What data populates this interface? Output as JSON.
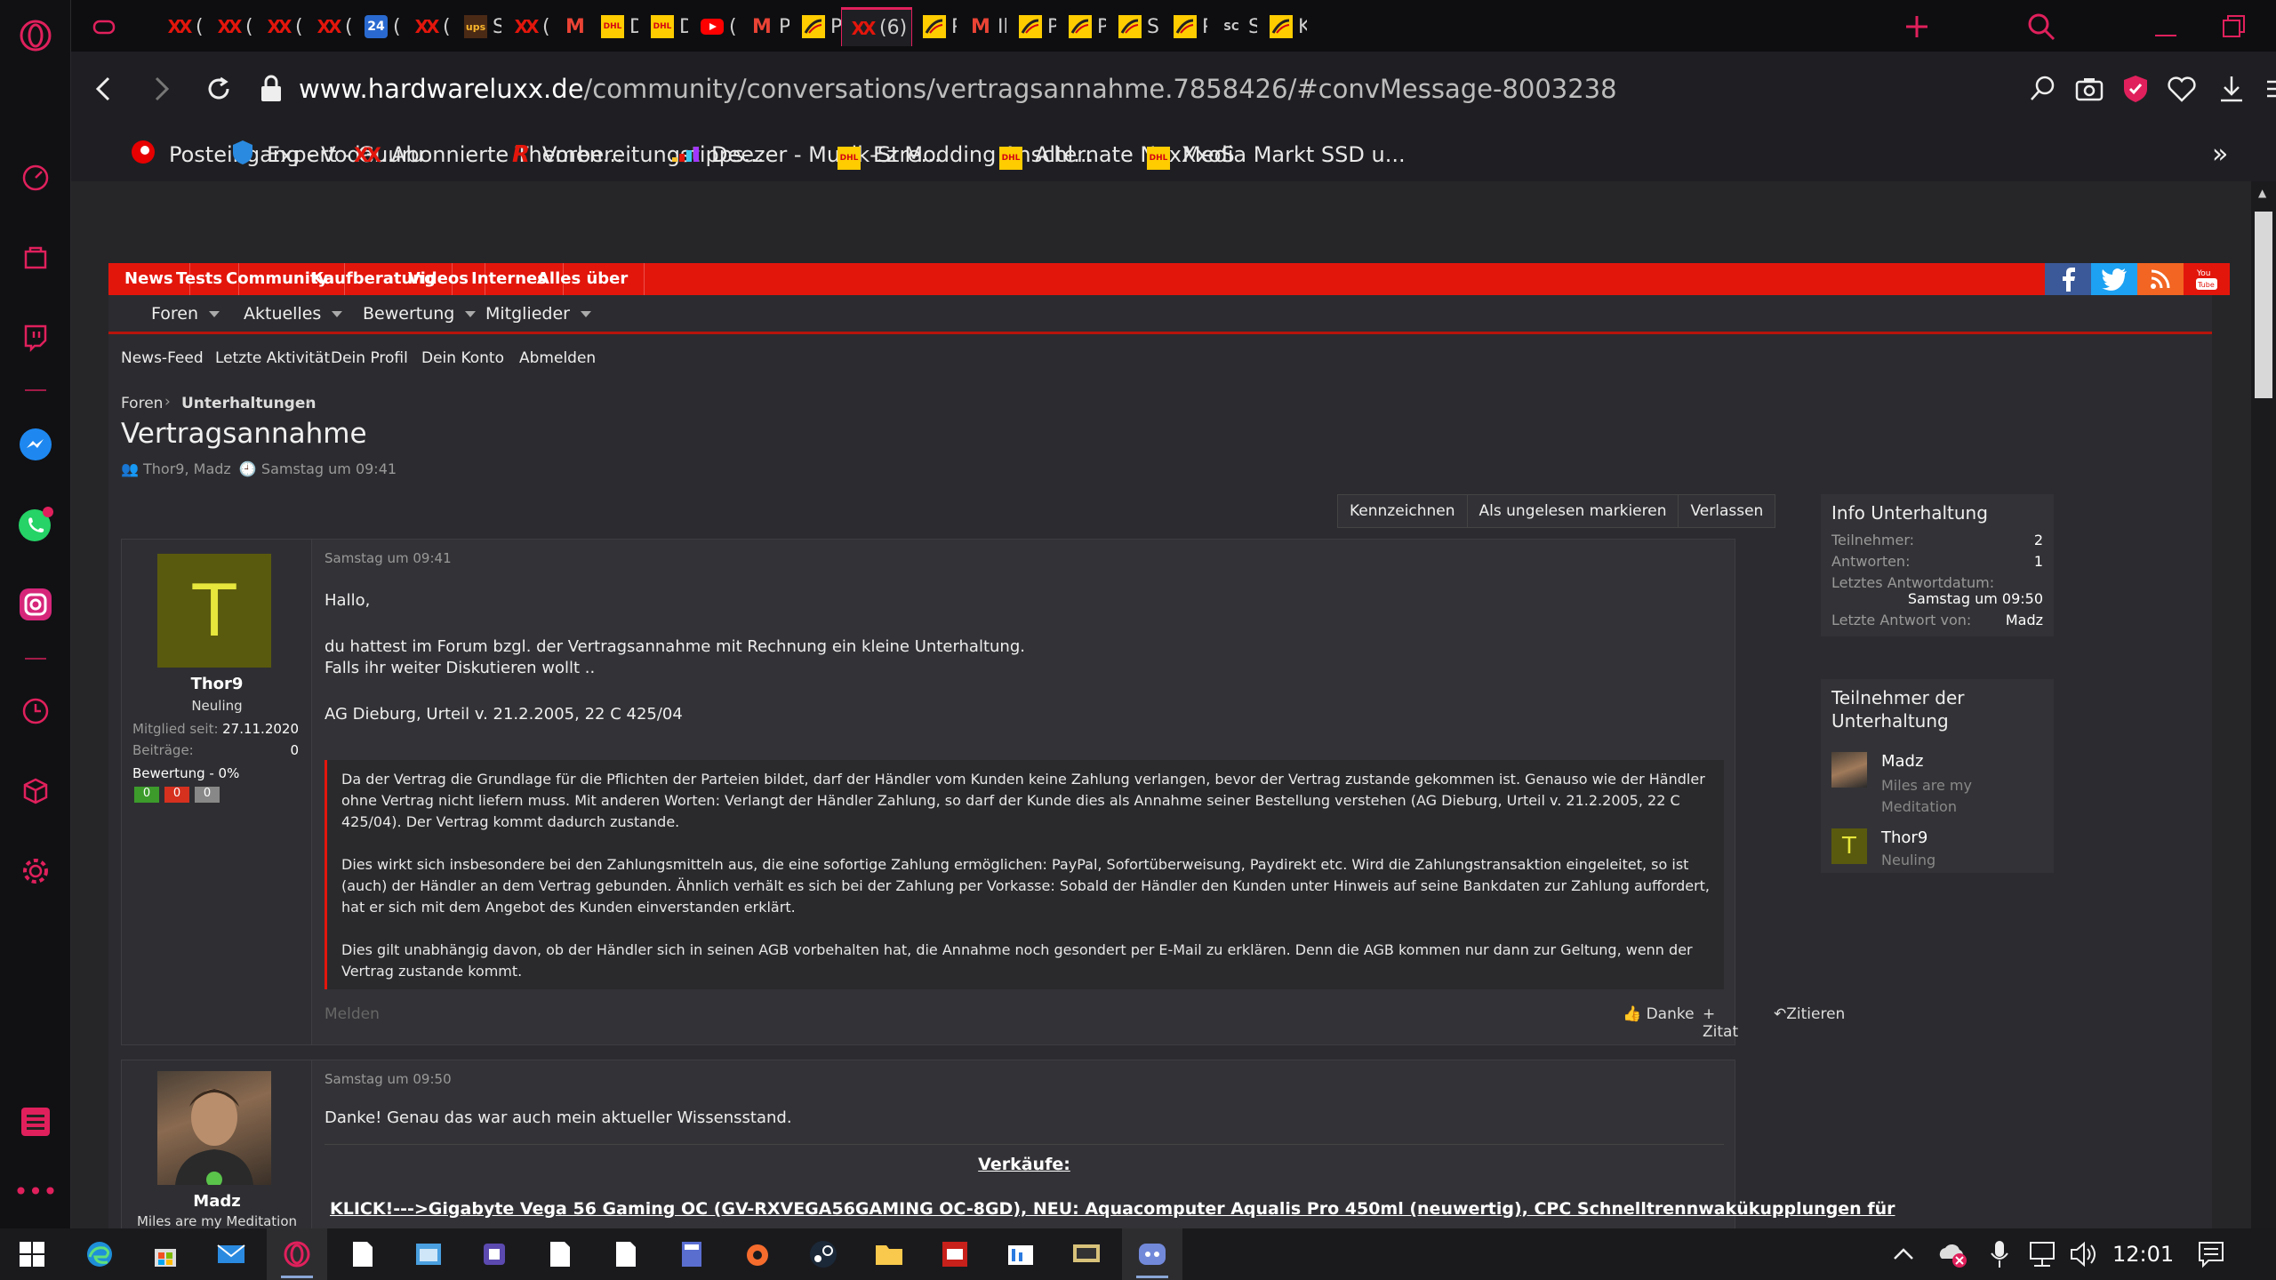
{
  "tabs": [
    {
      "favicon": "gamepad-icon",
      "label": "",
      "active": false
    },
    {
      "favicon": "hardwareluxx-icon",
      "label": "(E",
      "active": false
    },
    {
      "favicon": "hardwareluxx-icon",
      "label": "(E",
      "active": false
    },
    {
      "favicon": "hardwareluxx-icon",
      "label": "(E",
      "active": false
    },
    {
      "favicon": "hardwareluxx-icon",
      "label": "(E",
      "active": false
    },
    {
      "favicon": "24-icon",
      "label": "(E",
      "active": false
    },
    {
      "favicon": "hardwareluxx-icon",
      "label": "(E",
      "active": false
    },
    {
      "favicon": "ups-icon",
      "label": "Sı",
      "active": false
    },
    {
      "favicon": "hardwareluxx-icon",
      "label": "(E",
      "active": false
    },
    {
      "favicon": "gmail-icon",
      "label": "D",
      "active": false
    },
    {
      "favicon": "dhl-icon",
      "label": "D",
      "active": false
    },
    {
      "favicon": "dhl-icon",
      "label": "D",
      "active": false
    },
    {
      "favicon": "youtube-icon",
      "label": "(1",
      "active": false
    },
    {
      "favicon": "gmail-icon",
      "label": "Pı",
      "active": false
    },
    {
      "favicon": "deutsche-post-icon",
      "label": "Pı",
      "active": false
    },
    {
      "favicon": "hardwareluxx-icon",
      "label": "(6)",
      "active": true
    },
    {
      "favicon": "deutsche-post-icon",
      "label": "Pı",
      "active": false
    },
    {
      "favicon": "gmail-icon",
      "label": "Ih",
      "active": false
    },
    {
      "favicon": "deutsche-post-icon",
      "label": "Pı",
      "active": false
    },
    {
      "favicon": "deutsche-post-icon",
      "label": "Pı",
      "active": false
    },
    {
      "favicon": "deutsche-post-icon",
      "label": "S",
      "active": false
    },
    {
      "favicon": "deutsche-post-icon",
      "label": "Pı",
      "active": false
    },
    {
      "favicon": "sc-icon",
      "label": "S",
      "active": false
    },
    {
      "favicon": "deutsche-post-icon",
      "label": "K",
      "active": false
    }
  ],
  "address": {
    "domain": "www.hardwareluxx.de",
    "path": "/community/conversations/vertragsannahme.7858426/#convMessage-8003238"
  },
  "bookmarks": [
    {
      "icon": "vodafone-icon",
      "label": "Posteingang - Voda..."
    },
    {
      "icon": "guuru-icon",
      "label": "Expert - Guuru"
    },
    {
      "icon": "hardwareluxx-icon",
      "label": "Abonnierte Themen..."
    },
    {
      "icon": "r-icon",
      "label": "Vorbereitungstipps..."
    },
    {
      "icon": "deezer-icon",
      "label": "Deezer - Musik-Stre..."
    },
    {
      "icon": "dhl-icon",
      "label": "Ez Modding Anschl..."
    },
    {
      "icon": "dhl-icon",
      "label": "Alternate NexXxoS"
    },
    {
      "icon": "dhl-icon",
      "label": "Media Markt SSD u..."
    }
  ],
  "topnav": [
    "News",
    "Tests",
    "Community",
    "Kaufberatung",
    "Videos",
    "Internes",
    "Alles über"
  ],
  "subnav": [
    "Foren",
    "Aktuelles",
    "Bewertung",
    "Mitglieder"
  ],
  "subnav2": [
    "News-Feed",
    "Letzte Aktivität",
    "Dein Profil",
    "Dein Konto",
    "Abmelden"
  ],
  "breadcrumb": [
    "Foren",
    "Unterhaltungen"
  ],
  "title": "Vertragsannahme",
  "meta": {
    "participants": "Thor9, Madz",
    "date": "Samstag um 09:41"
  },
  "actions": [
    "Kennzeichnen",
    "Als ungelesen markieren",
    "Verlassen"
  ],
  "post1": {
    "user": "Thor9",
    "initial": "T",
    "rank": "Neuling",
    "joined_label": "Mitglied seit:",
    "joined": "27.11.2020",
    "posts_label": "Beiträge:",
    "posts": "0",
    "rating": "Bewertung - 0%",
    "votes": [
      "0",
      "0",
      "0"
    ],
    "date": "Samstag um 09:41",
    "lines": [
      "Hallo,",
      "du hattest im Forum bzgl. der Vertragsannahme mit Rechnung ein kleine Unterhaltung.",
      "Falls ihr weiter Diskutieren wollt ..",
      "AG Dieburg, Urteil v. 21.2.2005, 22 C 425/04"
    ],
    "quote": [
      "Da der Vertrag die Grundlage für die Pflichten der Parteien bildet, darf der Händler vom Kunden keine Zahlung verlangen, bevor der Vertrag zustande gekommen ist. Genauso wie der Händler ohne Vertrag nicht liefern muss. Mit anderen Worten: Verlangt der Händler Zahlung, so darf der Kunde dies als Annahme seiner Bestellung verstehen (AG Dieburg, Urteil v. 21.2.2005, 22 C 425/04). Der Vertrag kommt dadurch zustande.",
      "Dies wirkt sich insbesondere bei den Zahlungsmitteln aus, die eine sofortige Zahlung ermöglichen: PayPal, Sofortüberweisung, Paydirekt etc. Wird die Zahlungstransaktion eingeleitet, so ist (auch) der Händler an dem Vertrag gebunden. Ähnlich verhält es sich bei der Zahlung per Vorkasse: Sobald der Händler den Kunden unter Hinweis auf seine Bankdaten zur Zahlung auffordert, hat er sich mit dem Angebot des Kunden einverstanden erklärt.",
      "Dies gilt unabhängig davon, ob der Händler sich in seinen AGB vorbehalten hat, die Annahme noch gesondert per E-Mail zu erklären. Denn die AGB kommen nur dann zur Geltung, wenn der Vertrag zustande kommt."
    ],
    "report": "Melden",
    "thanks": "Danke",
    "plus_quote": "+ Zitat",
    "reply_quote": "Zitieren"
  },
  "post2": {
    "user": "Madz",
    "tagline": "Miles are my Meditation",
    "date": "Samstag um 09:50",
    "text": "Danke! Genau das war auch mein aktueller Wissensstand.",
    "sig_title": "Verkäufe:",
    "sig_link": "KLICK!--->Gigabyte Vega 56 Gaming OC (GV-RXVEGA56GAMING OC-8GD), NEU: Aquacomputer Aqualis Pro 450ml (neuwertig), CPC Schnelltrennwakükupplungen für"
  },
  "info": {
    "title": "Info Unterhaltung",
    "rows": [
      {
        "k": "Teilnehmer:",
        "v": "2"
      },
      {
        "k": "Antworten:",
        "v": "1"
      }
    ],
    "last_label": "Letztes Antwortdatum:",
    "last_date": "Samstag um 09:50",
    "last_from_label": "Letzte Antwort von:",
    "last_from": "Madz"
  },
  "participants": {
    "title": "Teilnehmer der Unterhaltung",
    "list": [
      {
        "name": "Madz",
        "sub": "Miles are my Meditation"
      },
      {
        "name": "Thor9",
        "sub": "Neuling",
        "initial": "T"
      }
    ]
  },
  "clock": "12:01",
  "colors": {
    "accent": "#e0205c",
    "forum_red": "#e3160c"
  }
}
